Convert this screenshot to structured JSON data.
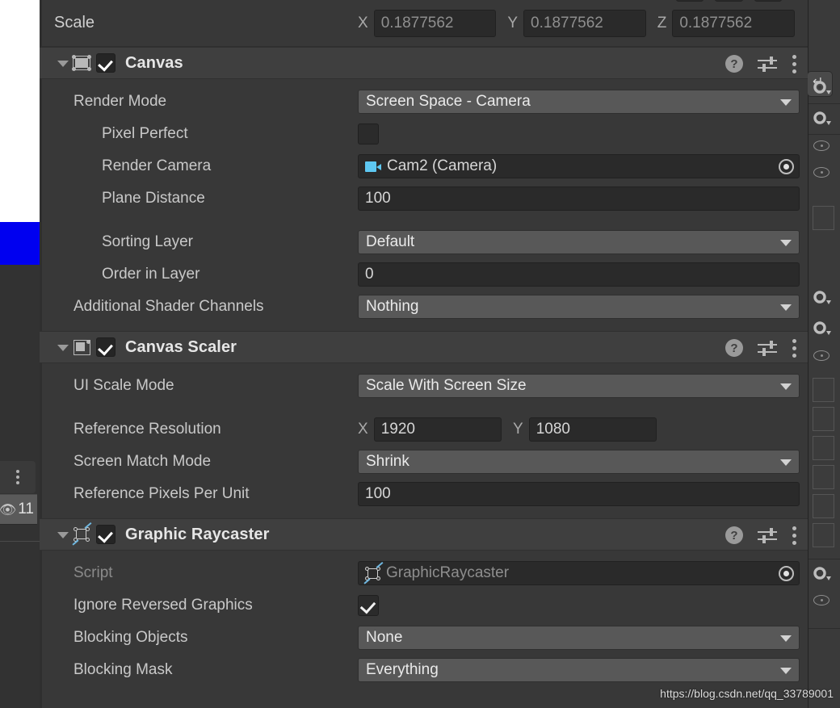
{
  "watermark": "https://blog.csdn.net/qq_33789001",
  "left_panel": {
    "badge_count": "11",
    "eye_icon": "eye-slash-icon",
    "menu_icon": "kebab-menu-icon"
  },
  "transform": {
    "scale": {
      "label": "Scale",
      "axes": [
        "X",
        "Y",
        "Z"
      ],
      "values": [
        "0.1877562",
        "0.1877562",
        "0.1877562"
      ]
    }
  },
  "components": [
    {
      "name": "Canvas",
      "icon": "canvas-icon",
      "enabled": true,
      "expanded": true,
      "help_label": "?",
      "rows": [
        {
          "label": "Render Mode",
          "type": "popup",
          "value": "Screen Space - Camera",
          "indent": 0
        },
        {
          "label": "Pixel Perfect",
          "type": "checkbox",
          "value": false,
          "indent": 1
        },
        {
          "label": "Render Camera",
          "type": "object",
          "value": "Cam2 (Camera)",
          "icon": "camera-icon",
          "indent": 1
        },
        {
          "label": "Plane Distance",
          "type": "text",
          "value": "100",
          "indent": 1
        },
        {
          "label": "Sorting Layer",
          "type": "popup",
          "value": "Default",
          "indent": 1,
          "gap_before": true
        },
        {
          "label": "Order in Layer",
          "type": "text",
          "value": "0",
          "indent": 1
        },
        {
          "label": "Additional Shader Channels",
          "type": "popup",
          "value": "Nothing",
          "indent": 0
        }
      ]
    },
    {
      "name": "Canvas Scaler",
      "icon": "canvas-scaler-icon",
      "enabled": true,
      "expanded": true,
      "help_label": "?",
      "rows": [
        {
          "label": "UI Scale Mode",
          "type": "popup",
          "value": "Scale With Screen Size",
          "indent": 0
        },
        {
          "label": "Reference Resolution",
          "type": "vector2",
          "axes": [
            "X",
            "Y"
          ],
          "values": [
            "1920",
            "1080"
          ],
          "indent": 0,
          "gap_before": true
        },
        {
          "label": "Screen Match Mode",
          "type": "popup",
          "value": "Shrink",
          "indent": 0
        },
        {
          "label": "Reference Pixels Per Unit",
          "type": "text",
          "value": "100",
          "indent": 0
        }
      ]
    },
    {
      "name": "Graphic Raycaster",
      "icon": "graphic-raycaster-icon",
      "enabled": true,
      "expanded": true,
      "help_label": "?",
      "rows": [
        {
          "label": "Script",
          "type": "object",
          "value": "GraphicRaycaster",
          "icon": "graphic-raycaster-icon",
          "disabled": true,
          "indent": 0
        },
        {
          "label": "Ignore Reversed Graphics",
          "type": "checkbox",
          "value": true,
          "indent": 0
        },
        {
          "label": "Blocking Objects",
          "type": "popup",
          "value": "None",
          "indent": 0
        },
        {
          "label": "Blocking Mask",
          "type": "popup",
          "value": "Everything",
          "indent": 0
        }
      ]
    }
  ]
}
